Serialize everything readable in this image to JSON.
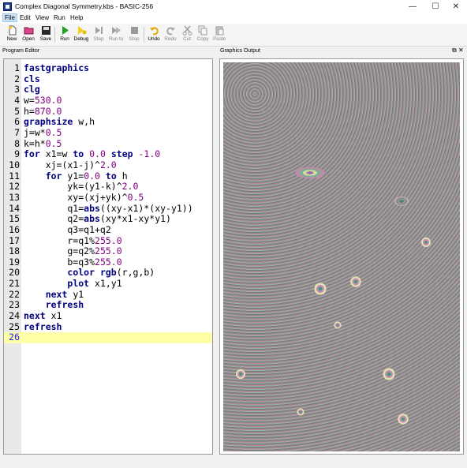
{
  "window": {
    "title": "Complex Diagonal Symmetry.kbs - BASIC-256",
    "minimize": "—",
    "maximize": "☐",
    "close": "✕"
  },
  "menu": [
    "File",
    "Edit",
    "View",
    "Run",
    "Help"
  ],
  "toolbar": {
    "new": "New",
    "open": "Open",
    "save": "Save",
    "run": "Run",
    "debug": "Debug",
    "step": "Step",
    "run_to": "Run to",
    "stop": "Stop",
    "undo": "Undo",
    "redo": "Redo",
    "cut": "Cut",
    "copy": "Copy",
    "paste": "Paste"
  },
  "panes": {
    "editor_title": "Program Editor",
    "graphics_title": "Graphics Output",
    "restore": "⧉",
    "close": "✕"
  },
  "code": {
    "current_line": 26,
    "lines": [
      [
        [
          "kw",
          "fastgraphics"
        ]
      ],
      [
        [
          "kw",
          "cls"
        ]
      ],
      [
        [
          "kw",
          "clg"
        ]
      ],
      [
        [
          "t",
          "w="
        ],
        [
          "num",
          "530.0"
        ]
      ],
      [
        [
          "t",
          "h="
        ],
        [
          "num",
          "870.0"
        ]
      ],
      [
        [
          "kw",
          "graphsize"
        ],
        [
          "t",
          " w,h"
        ]
      ],
      [
        [
          "t",
          "j=w*"
        ],
        [
          "num",
          "0.5"
        ]
      ],
      [
        [
          "t",
          "k=h*"
        ],
        [
          "num",
          "0.5"
        ]
      ],
      [
        [
          "kw",
          "for"
        ],
        [
          "t",
          " x1=w "
        ],
        [
          "kw",
          "to"
        ],
        [
          "t",
          " "
        ],
        [
          "num",
          "0.0"
        ],
        [
          "t",
          " "
        ],
        [
          "kw",
          "step"
        ],
        [
          "t",
          " "
        ],
        [
          "num",
          "-1.0"
        ]
      ],
      [
        [
          "t",
          "    xj=(x1-j)^"
        ],
        [
          "num",
          "2.0"
        ]
      ],
      [
        [
          "t",
          "    "
        ],
        [
          "kw",
          "for"
        ],
        [
          "t",
          " y1="
        ],
        [
          "num",
          "0.0"
        ],
        [
          "t",
          " "
        ],
        [
          "kw",
          "to"
        ],
        [
          "t",
          " h"
        ]
      ],
      [
        [
          "t",
          "        yk=(y1-k)^"
        ],
        [
          "num",
          "2.0"
        ]
      ],
      [
        [
          "t",
          "        xy=(xj+yk)^"
        ],
        [
          "num",
          "0.5"
        ]
      ],
      [
        [
          "t",
          "        q1="
        ],
        [
          "kw",
          "abs"
        ],
        [
          "t",
          "((xy-x1)*(xy-y1))"
        ]
      ],
      [
        [
          "t",
          "        q2="
        ],
        [
          "kw",
          "abs"
        ],
        [
          "t",
          "(xy*x1-xy*y1)"
        ]
      ],
      [
        [
          "t",
          "        q3=q1+q2"
        ]
      ],
      [
        [
          "t",
          "        r=q1%"
        ],
        [
          "num",
          "255.0"
        ]
      ],
      [
        [
          "t",
          "        g=q2%"
        ],
        [
          "num",
          "255.0"
        ]
      ],
      [
        [
          "t",
          "        b=q3%"
        ],
        [
          "num",
          "255.0"
        ]
      ],
      [
        [
          "t",
          "        "
        ],
        [
          "kw",
          "color"
        ],
        [
          "t",
          " "
        ],
        [
          "kw",
          "rgb"
        ],
        [
          "t",
          "(r,g,b)"
        ]
      ],
      [
        [
          "t",
          "        "
        ],
        [
          "kw",
          "plot"
        ],
        [
          "t",
          " x1,y1"
        ]
      ],
      [
        [
          "t",
          "    "
        ],
        [
          "kw",
          "next"
        ],
        [
          "t",
          " y1"
        ]
      ],
      [
        [
          "t",
          "    "
        ],
        [
          "kw",
          "refresh"
        ]
      ],
      [
        [
          "kw",
          "next"
        ],
        [
          "t",
          " x1"
        ]
      ],
      [
        [
          "kw",
          "refresh"
        ]
      ],
      []
    ]
  }
}
